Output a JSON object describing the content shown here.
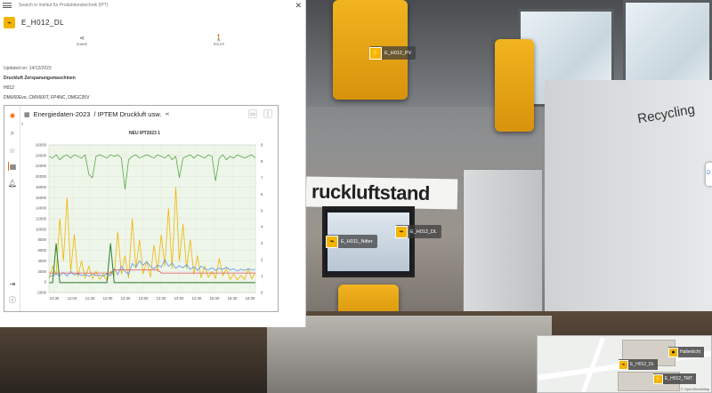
{
  "search": {
    "placeholder": "Search in Institut für Produktionstechnik (IPT)"
  },
  "poi": {
    "title": "E_H012_DL",
    "actions": [
      {
        "label": "SHARE",
        "icon": "share-icon"
      },
      {
        "label": "ROUTE",
        "icon": "walking-person-icon"
      }
    ],
    "updated": "Updated on: 14/12/2023",
    "heading": "Druckluft Zerspanungsmaschinen",
    "room": "H012",
    "machines": "DMU60Evo, CMX600T, FP4NC, DMGC35V"
  },
  "dashboard": {
    "title": "Energiedaten-2023",
    "breadcrumb": "/ IPTEM Druckluft usw.",
    "side_icons": [
      "grafana-logo-icon",
      "search-icon",
      "star-icon",
      "dashboards-icon",
      "bell-icon"
    ],
    "side_bottom_icons": [
      "sign-in-icon",
      "help-icon"
    ],
    "colors": {
      "green": "#5aa64b",
      "yellow": "#f0b400",
      "blue": "#5794f2",
      "red": "#e0545c",
      "dark_green": "#2e7d32"
    }
  },
  "chart_data": {
    "type": "line",
    "title": "NEU IPT2023 1",
    "xlabel": "",
    "ylabel": "",
    "x_ticks": [
      "10:30",
      "11:00",
      "11:30",
      "12:00",
      "12:30",
      "13:00",
      "13:30",
      "14:00",
      "14:30",
      "15:00",
      "15:30",
      "16:00"
    ],
    "y_left_ticks": [
      26000,
      24000,
      22000,
      20000,
      18000,
      16000,
      14000,
      12000,
      10000,
      8000,
      6000,
      4000,
      2000,
      0,
      -2000
    ],
    "y_right_ticks": [
      9,
      8,
      7,
      6,
      5,
      4,
      3,
      2,
      1,
      0
    ],
    "ylim": [
      -2000,
      26000
    ],
    "y2lim": [
      0,
      9
    ],
    "series": [
      {
        "color": "green",
        "axis": "right",
        "values": [
          8.3,
          8.2,
          8.4,
          8.1,
          8.3,
          8.4,
          8.2,
          8.4,
          8.3,
          8.2,
          8.4,
          7.2,
          7.0,
          8.3,
          8.4,
          8.3,
          8.2,
          8.4,
          8.3,
          8.4,
          8.2,
          6.3,
          8.1,
          8.3,
          8.4,
          8.2,
          8.3,
          8.4,
          8.3,
          8.2,
          8.4,
          8.3,
          8.2,
          8.4,
          8.1,
          8.3,
          7.0,
          8.2,
          8.3,
          8.4,
          8.2,
          8.4,
          8.3,
          8.2,
          8.4,
          8.3,
          6.8,
          8.2,
          8.4,
          8.1,
          8.3,
          8.2,
          8.4,
          8.3,
          8.2,
          8.3,
          8.4,
          8.2
        ]
      },
      {
        "color": "yellow",
        "axis": "left",
        "values": [
          500,
          3000,
          1500,
          12000,
          4000,
          16000,
          2000,
          9000,
          1000,
          4000,
          800,
          3000,
          600,
          2000,
          500,
          1500,
          300,
          2000,
          1200,
          9500,
          1500,
          5000,
          700,
          12000,
          2500,
          8000,
          1500,
          4000,
          900,
          7000,
          2000,
          9000,
          3000,
          14000,
          2500,
          18000,
          4000,
          11000,
          2500,
          8000,
          1500,
          5000,
          800,
          3000,
          900,
          2000,
          700,
          4500,
          1200,
          2500,
          500,
          1500,
          400,
          1200,
          500,
          2500,
          600,
          1800
        ]
      },
      {
        "color": "blue",
        "axis": "left",
        "values": [
          1000,
          1200,
          1500,
          1200,
          1800,
          1100,
          2000,
          1300,
          1600,
          1200,
          1400,
          1100,
          1500,
          1200,
          1300,
          1100,
          1600,
          1200,
          2500,
          1400,
          3000,
          2000,
          1500,
          3500,
          2800,
          4000,
          3200,
          3800,
          3000,
          2500,
          3200,
          2800,
          4200,
          3000,
          3600,
          2600,
          3100,
          2700,
          3300,
          2400,
          2900,
          2200,
          3000,
          2500,
          2300,
          2700,
          2200,
          2600,
          2400,
          2800,
          2300,
          2500,
          2100,
          2400,
          2200,
          2500,
          2300,
          2400
        ]
      },
      {
        "color": "red",
        "axis": "left",
        "values": [
          1700,
          1700,
          1700,
          1700,
          1700,
          1700,
          1700,
          1700,
          1700,
          1700,
          1700,
          1700,
          1700,
          1700,
          1700,
          1700,
          1700,
          1700,
          2300,
          2300,
          2300,
          2300,
          2300,
          2300,
          2300,
          2300,
          2300,
          2300,
          2300,
          2300,
          2300,
          1700,
          1700,
          1700,
          1700,
          1700,
          1700,
          1700,
          1700,
          1700,
          1700,
          1700,
          1700,
          1700,
          1700,
          1700,
          1700,
          1700,
          1700,
          1700,
          1700,
          1700,
          1700,
          1700,
          1700,
          1700,
          1700,
          1700
        ]
      },
      {
        "color": "dark_green",
        "axis": "right",
        "values": [
          0.6,
          0.6,
          3.0,
          0.6,
          0.6,
          0.6,
          0.6,
          0.6,
          0.6,
          0.6,
          0.6,
          0.6,
          0.6,
          0.6,
          0.6,
          0.6,
          0.6,
          3.0,
          0.6,
          0.6,
          0.6,
          0.6,
          0.6,
          0.6,
          0.6,
          0.6,
          0.6,
          0.6,
          0.6,
          0.6,
          0.6,
          0.6,
          0.6,
          0.6,
          0.6,
          0.6,
          0.6,
          0.6,
          0.6,
          0.6,
          0.6,
          0.6,
          0.6,
          0.6,
          0.6,
          0.6,
          0.6,
          0.6,
          0.6,
          0.6,
          0.6,
          0.6,
          0.6,
          0.6,
          0.6,
          0.6,
          0.6,
          0.6
        ]
      }
    ],
    "grid": true
  },
  "scene": {
    "banner": "ruckluftstand",
    "wall_text": "Recycling",
    "hotspots": [
      {
        "label": "E_H012_PV",
        "icon": "lightning-icon"
      },
      {
        "label": "E_H011_Nitter",
        "icon": "plug-icon"
      },
      {
        "label": "E_H012_DL",
        "icon": "plug-icon"
      }
    ],
    "edge_tab": "D"
  },
  "minimap": {
    "pins": [
      {
        "label": "Hallenlicht",
        "icon": "lightbulb-icon"
      },
      {
        "label": "E_H012_DL",
        "icon": "plug-icon"
      },
      {
        "label": "E_H012_TMT",
        "icon": "lightning-icon"
      }
    ],
    "attribution": "© OpenStreetMap"
  }
}
